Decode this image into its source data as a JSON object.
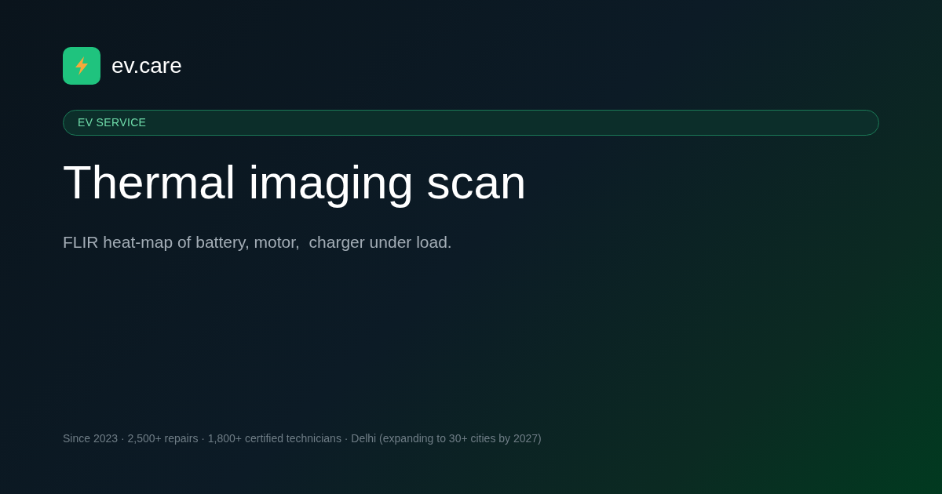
{
  "brand": {
    "name": "ev.care"
  },
  "badge": "EV SERVICE",
  "title": "Thermal imaging scan",
  "subtitle": "FLIR heat-map of battery, motor,  charger under load.",
  "footer": "Since 2023 · 2,500+ repairs · 1,800+ certified technicians · Delhi (expanding to 30+ cities by 2027)"
}
